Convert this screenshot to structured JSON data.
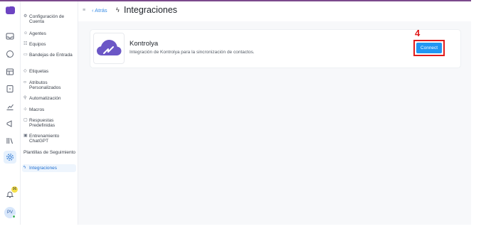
{
  "colors": {
    "brand": "#6d44c2",
    "accent": "#2196f3",
    "highlight": "#e11b1b"
  },
  "rail": {
    "icons": [
      "inbox-icon",
      "chat-icon",
      "contacts-icon",
      "reports-icon",
      "chart-icon",
      "campaign-icon",
      "library-icon",
      "settings-icon",
      "bell-icon"
    ],
    "notification_count": "96",
    "avatar_initials": "PV"
  },
  "sidebar": {
    "items": [
      {
        "label": "Configuración de Cuenta",
        "icon": "settings-icon"
      },
      {
        "label": "Agentes",
        "icon": "people-icon"
      },
      {
        "label": "Equipos",
        "icon": "team-icon"
      },
      {
        "label": "Bandejas de Entrada",
        "icon": "inbox-icon"
      },
      {
        "label": "Etiquetas",
        "icon": "tag-icon"
      },
      {
        "label": "Atributos Personalizados",
        "icon": "code-icon"
      },
      {
        "label": "Automatización",
        "icon": "automation-icon"
      },
      {
        "label": "Macros",
        "icon": "macro-icon"
      },
      {
        "label": "Respuestas Predefinidas",
        "icon": "reply-icon"
      },
      {
        "label": "Entrenamiento ChatGPT",
        "icon": "bot-icon"
      },
      {
        "label": "Plantillas de Seguimiento",
        "icon": ""
      },
      {
        "label": "Integraciones",
        "icon": "plug-icon"
      }
    ]
  },
  "header": {
    "back_label": "Atrás",
    "title": "Integraciones"
  },
  "integration": {
    "name": "Kontrolya",
    "description": "Integración de Kontrolya para la sincronización de contactos.",
    "connect_label": "Connect",
    "step_number": "4"
  }
}
